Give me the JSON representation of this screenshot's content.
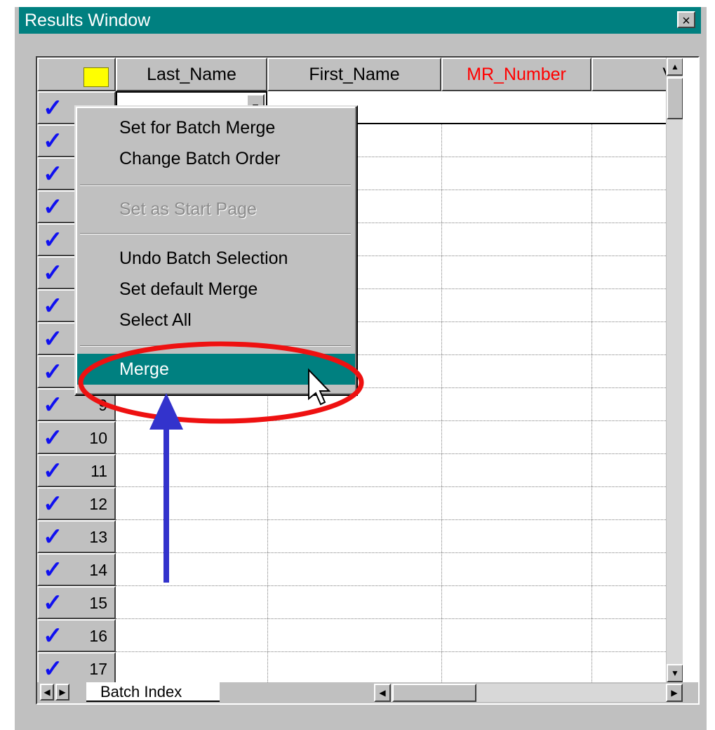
{
  "window": {
    "title": "Results Window",
    "close_glyph": "×"
  },
  "grid": {
    "columns": [
      "",
      "Last_Name",
      "First_Name",
      "MR_Number",
      "V"
    ],
    "highlight_column_color": "#ff0000",
    "row_numbers": [
      "9",
      "10",
      "11",
      "12",
      "13",
      "14",
      "15",
      "16",
      "17"
    ],
    "check_glyph": "✓",
    "check_color": "#1010f0"
  },
  "context_menu": {
    "items": [
      {
        "label": "Set for Batch Merge",
        "state": "enabled"
      },
      {
        "label": "Change Batch Order",
        "state": "enabled"
      },
      {
        "label": "Set as Start Page",
        "state": "disabled"
      },
      {
        "label": "Undo Batch Selection",
        "state": "enabled"
      },
      {
        "label": "Set default Merge",
        "state": "enabled"
      },
      {
        "label": "Select All",
        "state": "enabled"
      },
      {
        "label": "Merge",
        "state": "highlighted"
      }
    ],
    "highlight_color": "#008080"
  },
  "tabs": {
    "active": "Batch Index"
  },
  "annotations": {
    "ellipse_color": "#ee1111",
    "arrow_color": "#3333cc"
  },
  "colors": {
    "titlebar": "#008080",
    "face": "#c0c0c0"
  }
}
